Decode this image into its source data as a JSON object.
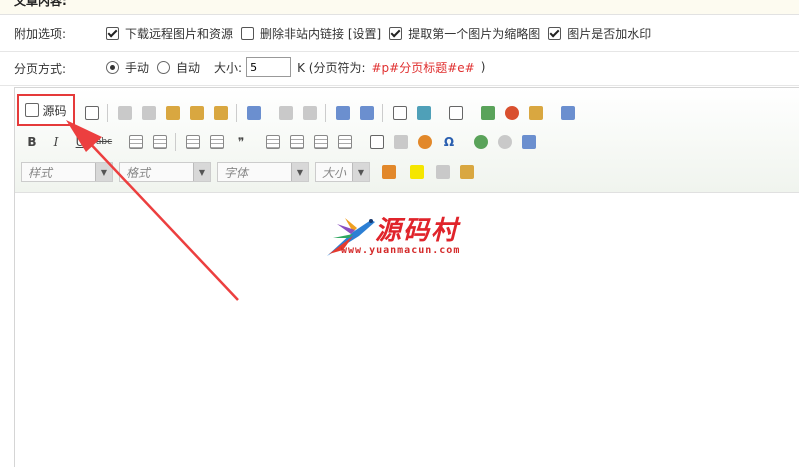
{
  "section_title": "文章内容:",
  "options_row": {
    "label": "附加选项:",
    "items": [
      {
        "label": "下载远程图片和资源",
        "checked": true
      },
      {
        "label": "删除非站内链接 [设置]",
        "checked": false
      },
      {
        "label": "提取第一个图片为缩略图",
        "checked": true
      },
      {
        "label": "图片是否加水印",
        "checked": true
      }
    ]
  },
  "paging_row": {
    "label": "分页方式:",
    "manual_label": "手动",
    "auto_label": "自动",
    "size_label": "大小:",
    "size_value": "5",
    "unit_text": "K (分页符为:",
    "separator_token": "#p#分页标题#e#",
    "close_paren": ")"
  },
  "toolbar": {
    "source_label": "源码",
    "combos": {
      "style": "样式",
      "format": "格式",
      "font": "字体",
      "size": "大小"
    },
    "bold_glyph": "B",
    "italic_glyph": "I",
    "underline_glyph": "U",
    "strike_glyph": "abc",
    "quote_glyph": "❞",
    "omega_glyph": "Ω"
  },
  "logo": {
    "name": "源码村",
    "url": "www.yuanmacun.com"
  },
  "colors": {
    "highlight": "#e53a3a",
    "logo_red": "#e0242b"
  }
}
